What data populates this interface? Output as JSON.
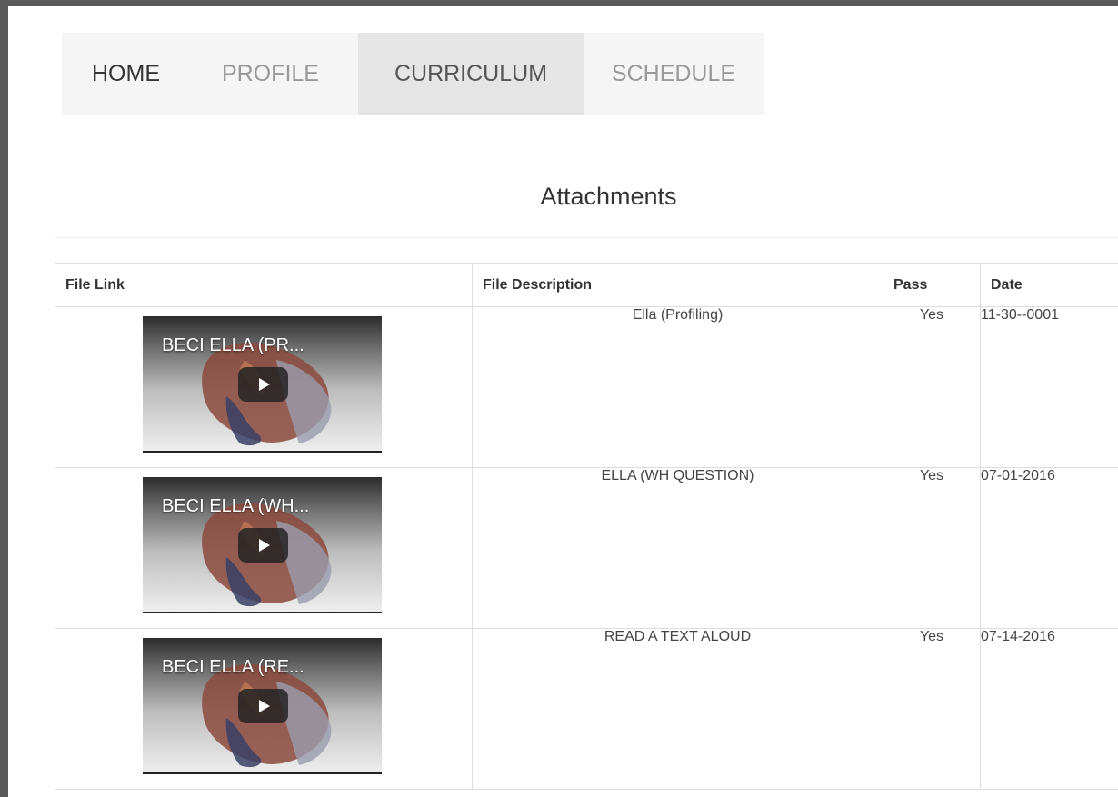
{
  "nav": {
    "items": [
      "HOME",
      "PROFILE",
      "CURRICULUM",
      "SCHEDULE"
    ],
    "active": "CURRICULUM"
  },
  "section": {
    "title": "Attachments"
  },
  "table": {
    "headers": [
      "File Link",
      "File Description",
      "Pass",
      "Date"
    ],
    "rows": [
      {
        "video_title": "BECI ELLA (PR...",
        "description": "Ella (Profiling)",
        "pass": "Yes",
        "date": "11-30--0001"
      },
      {
        "video_title": "BECI ELLA (WH...",
        "description": "ELLA (WH QUESTION)",
        "pass": "Yes",
        "date": "07-01-2016"
      },
      {
        "video_title": "BECI ELLA (RE...",
        "description": "READ A TEXT ALOUD",
        "pass": "Yes",
        "date": "07-14-2016"
      }
    ]
  },
  "icons": {
    "play": "play-icon"
  },
  "colors": {
    "nav_bg": "#f5f5f5",
    "nav_active_bg": "#e5e5e5",
    "frame": "#5a5a5a"
  }
}
